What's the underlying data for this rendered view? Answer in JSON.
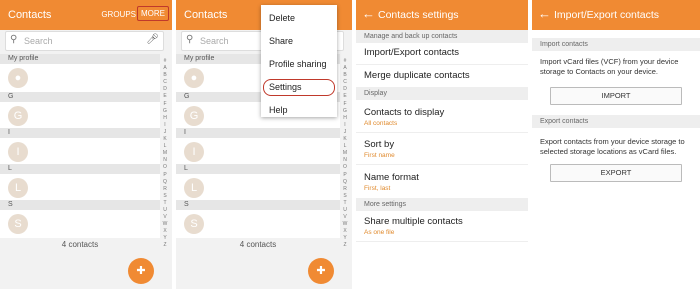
{
  "panel1": {
    "title": "Contacts",
    "groups": "GROUPS",
    "more": "MORE",
    "search_placeholder": "Search",
    "sections": [
      "My profile",
      "G",
      "I",
      "L",
      "S"
    ],
    "avatar_letters": [
      "",
      "G",
      "I",
      "L",
      "S"
    ],
    "count": "4 contacts",
    "alphabet": [
      "#",
      "A",
      "B",
      "C",
      "D",
      "E",
      "F",
      "G",
      "H",
      "I",
      "J",
      "K",
      "L",
      "M",
      "N",
      "O",
      "P",
      "Q",
      "R",
      "S",
      "T",
      "U",
      "V",
      "W",
      "X",
      "Y",
      "Z"
    ]
  },
  "panel2": {
    "title": "Contacts",
    "search_placeholder": "Search",
    "sections": [
      "My profile",
      "G",
      "I",
      "L",
      "S"
    ],
    "avatar_letters": [
      "",
      "G",
      "I",
      "L",
      "S"
    ],
    "count": "4 contacts",
    "menu": [
      "Delete",
      "Share",
      "Profile sharing",
      "Settings",
      "Help"
    ],
    "alphabet": [
      "#",
      "A",
      "B",
      "C",
      "D",
      "E",
      "F",
      "G",
      "H",
      "I",
      "J",
      "K",
      "L",
      "M",
      "N",
      "O",
      "P",
      "Q",
      "R",
      "S",
      "T",
      "U",
      "V",
      "W",
      "X",
      "Y",
      "Z"
    ]
  },
  "panel3": {
    "title": "Contacts settings",
    "h_manage": "Manage and back up contacts",
    "import_export": "Import/Export contacts",
    "merge": "Merge duplicate contacts",
    "h_display": "Display",
    "display": "Contacts to display",
    "display_sub": "All contacts",
    "sort": "Sort by",
    "sort_sub": "First name",
    "name_format": "Name format",
    "name_format_sub": "First, last",
    "h_more": "More settings",
    "share": "Share multiple contacts",
    "share_sub": "As one file"
  },
  "panel4": {
    "title": "Import/Export contacts",
    "h_import": "Import contacts",
    "import_desc": "Import vCard files (VCF) from your device storage to Contacts on your device.",
    "import_btn": "IMPORT",
    "h_export": "Export contacts",
    "export_desc": "Export contacts from your device storage to selected storage locations as vCard files.",
    "export_btn": "EXPORT"
  },
  "colors": {
    "accent": "#f08a33",
    "highlight": "#c0392b"
  }
}
